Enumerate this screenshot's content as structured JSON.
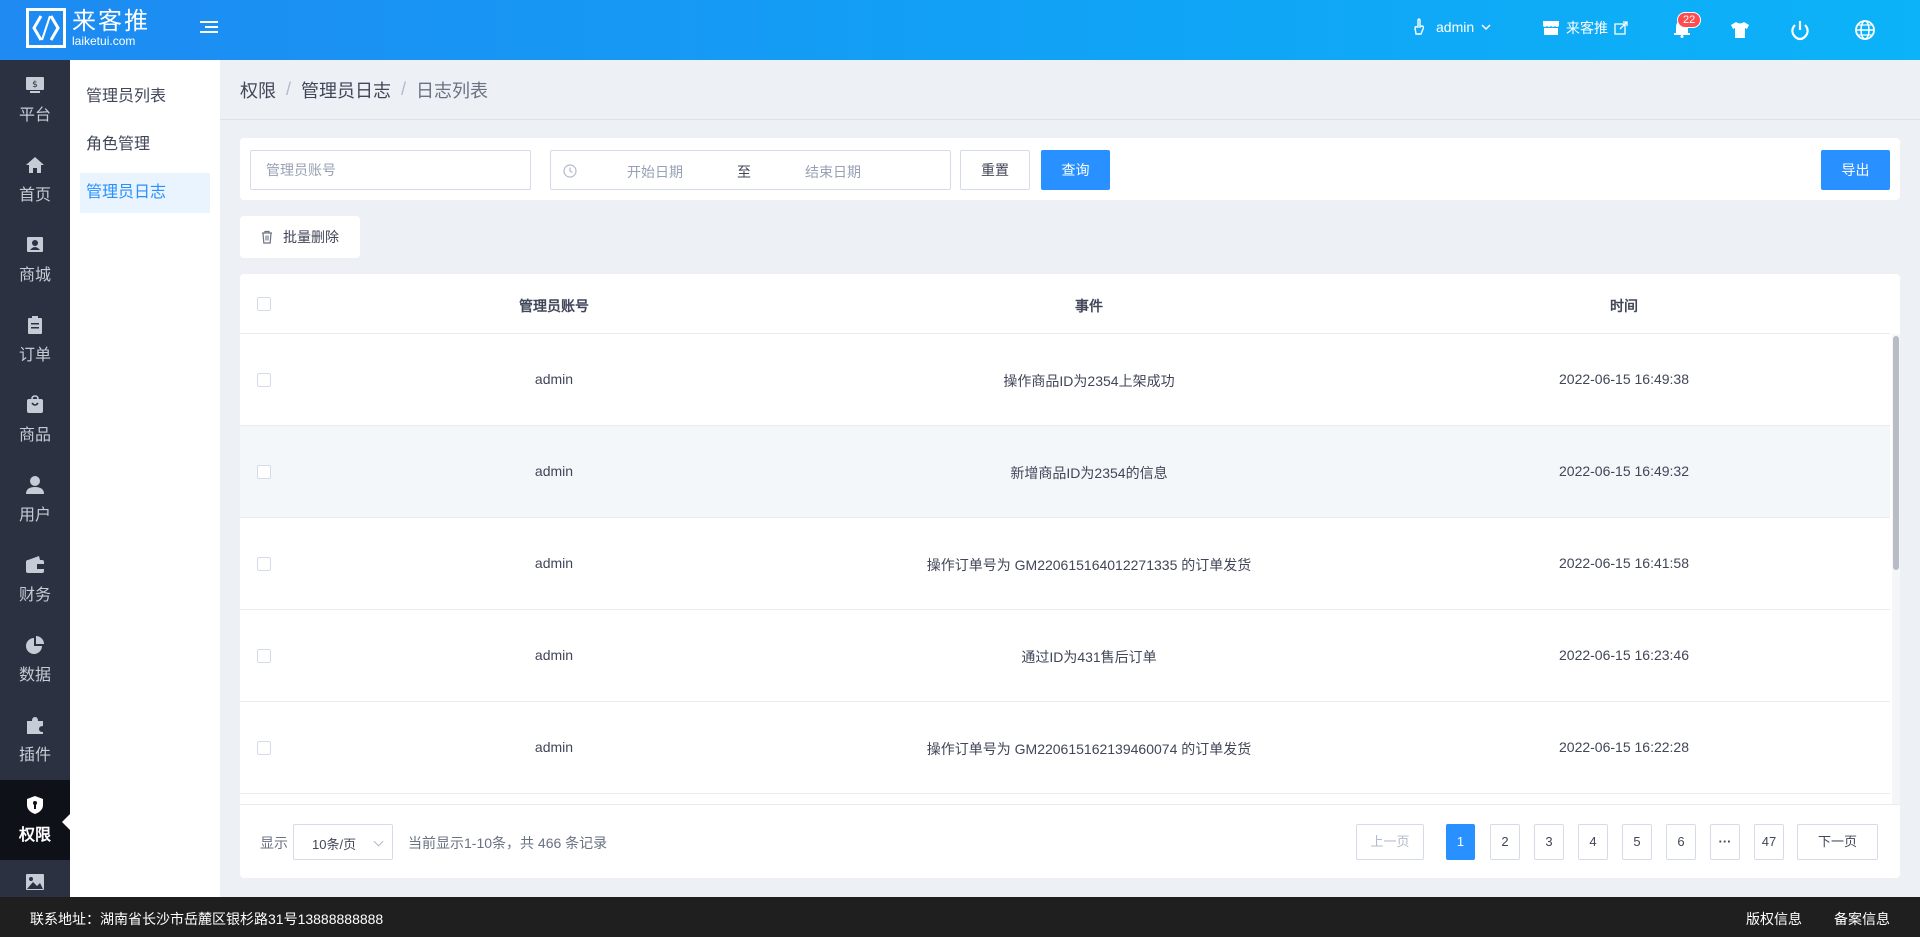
{
  "header": {
    "logo_cn": "来客推",
    "logo_en": "laiketui.com",
    "user": "admin",
    "shop": "来客推",
    "notification_count": "22"
  },
  "sidebar": {
    "items": [
      {
        "label": "平台",
        "icon": "platform-icon"
      },
      {
        "label": "首页",
        "icon": "home-icon"
      },
      {
        "label": "商城",
        "icon": "mall-icon"
      },
      {
        "label": "订单",
        "icon": "order-icon"
      },
      {
        "label": "商品",
        "icon": "goods-icon"
      },
      {
        "label": "用户",
        "icon": "user-icon"
      },
      {
        "label": "财务",
        "icon": "wallet-icon"
      },
      {
        "label": "数据",
        "icon": "pie-chart-icon"
      },
      {
        "label": "插件",
        "icon": "puzzle-icon"
      },
      {
        "label": "权限",
        "icon": "shield-icon",
        "active": true
      },
      {
        "label": "",
        "icon": "image-icon"
      }
    ]
  },
  "submenu": {
    "items": [
      "管理员列表",
      "角色管理",
      "管理员日志"
    ],
    "active_index": 2
  },
  "breadcrumb": [
    "权限",
    "管理员日志",
    "日志列表"
  ],
  "filter": {
    "account_placeholder": "管理员账号",
    "start_placeholder": "开始日期",
    "separator": "至",
    "end_placeholder": "结束日期",
    "reset_label": "重置",
    "query_label": "查询",
    "export_label": "导出"
  },
  "batch_delete_label": "批量删除",
  "table": {
    "headers": [
      "管理员账号",
      "事件",
      "时间"
    ],
    "rows": [
      {
        "account": "admin",
        "event": "操作商品ID为2354上架成功",
        "time": "2022-06-15 16:49:38"
      },
      {
        "account": "admin",
        "event": "新增商品ID为2354的信息",
        "time": "2022-06-15 16:49:32"
      },
      {
        "account": "admin",
        "event": "操作订单号为 GM220615164012271335 的订单发货",
        "time": "2022-06-15 16:41:58"
      },
      {
        "account": "admin",
        "event": "通过ID为431售后订单",
        "time": "2022-06-15 16:23:46"
      },
      {
        "account": "admin",
        "event": "操作订单号为 GM220615162139460074 的订单发货",
        "time": "2022-06-15 16:22:28"
      }
    ]
  },
  "pagination": {
    "show_label": "显示",
    "page_size": "10条/页",
    "info": "当前显示1-10条，共 466 条记录",
    "prev": "上一页",
    "next": "下一页",
    "pages": [
      "1",
      "2",
      "3",
      "4",
      "5",
      "6",
      "···",
      "47"
    ],
    "current": "1"
  },
  "footer": {
    "address": "联系地址：湖南省长沙市岳麓区银杉路31号13888888888",
    "link1": "版权信息",
    "link2": "备案信息"
  },
  "colors": {
    "primary": "#2890ff",
    "sidebar_bg": "#2b3140",
    "header_start": "#1e8af2",
    "header_end": "#0cb3f8",
    "badge": "#ff4d4f"
  }
}
